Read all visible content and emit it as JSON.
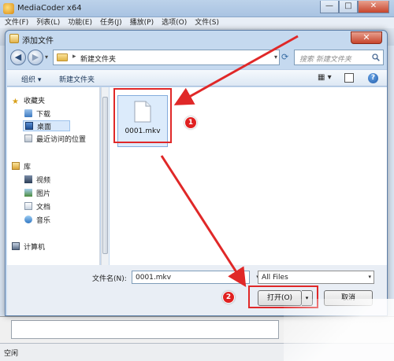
{
  "app": {
    "title": "MediaCoder x64",
    "menu": [
      "文件(F)",
      "列表(L)",
      "功能(E)",
      "任务(J)",
      "播放(P)",
      "选项(O)",
      "文件(S)"
    ],
    "window_buttons": [
      "—",
      "□",
      "✕"
    ],
    "status_text": "空闲"
  },
  "dialog": {
    "title": "添加文件",
    "close_glyph": "✕",
    "address": {
      "separator": "▸",
      "path": "新建文件夹"
    },
    "search": {
      "placeholder": "搜索 新建文件夹"
    },
    "commands": {
      "organize": "组织 ▾",
      "new_folder": "新建文件夹"
    },
    "nav_pane": {
      "favorites": {
        "label": "收藏夹",
        "items": [
          "下载",
          "桌面",
          "最近访问的位置"
        ],
        "selected": "桌面"
      },
      "libraries": {
        "label": "库",
        "items": [
          "视频",
          "图片",
          "文档",
          "音乐"
        ]
      },
      "computer": "计算机"
    },
    "files": [
      {
        "name": "0001.mkv",
        "icon": "document-icon",
        "selected": true
      }
    ],
    "filename_label": "文件名(N):",
    "filename_value": "0001.mkv",
    "filetype_value": "All Files",
    "open_button": "打开(O)",
    "open_split": "▾",
    "cancel_button": "取消"
  },
  "annotations": [
    {
      "label": "1"
    },
    {
      "label": "2"
    }
  ],
  "colors": {
    "annotation": "#e02828",
    "selection": "#dcebfb",
    "dialog_chrome": "#c5d9ef"
  }
}
